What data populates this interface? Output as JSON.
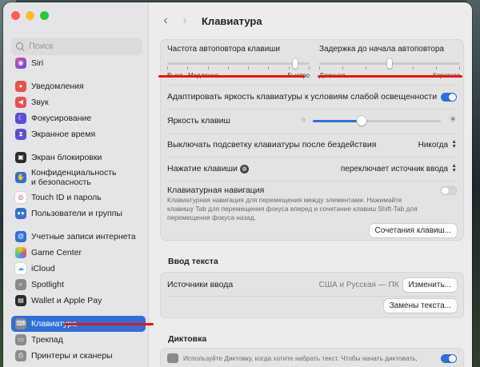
{
  "window": {
    "title": "Клавиатура"
  },
  "search": {
    "placeholder": "Поиск"
  },
  "sidebar": {
    "items": [
      {
        "label": "Siri",
        "icon": "siri-icon",
        "color": "#b04fd1"
      },
      {
        "label": "Уведомления",
        "icon": "bell-icon",
        "color": "#ec4d4d"
      },
      {
        "label": "Звук",
        "icon": "speaker-icon",
        "color": "#ec4d4d"
      },
      {
        "label": "Фокусирование",
        "icon": "moon-icon",
        "color": "#5a4fd6"
      },
      {
        "label": "Экранное время",
        "icon": "hourglass-icon",
        "color": "#5a4fd6"
      },
      {
        "label": "Экран блокировки",
        "icon": "lock-screen-icon",
        "color": "#2b2b2b"
      },
      {
        "label": "Конфиденциальность",
        "label2": "и безопасность",
        "icon": "hand-icon",
        "color": "#2f6fd7"
      },
      {
        "label": "Touch ID и пароль",
        "icon": "fingerprint-icon",
        "color": "#ffffff"
      },
      {
        "label": "Пользователи и группы",
        "icon": "users-icon",
        "color": "#2f6fd7"
      },
      {
        "label": "Учетные записи интернета",
        "icon": "at-icon",
        "color": "#2f6fd7"
      },
      {
        "label": "Game Center",
        "icon": "game-center-icon",
        "color": "#ffffff"
      },
      {
        "label": "iCloud",
        "icon": "cloud-icon",
        "color": "#3f9cf0"
      },
      {
        "label": "Spotlight",
        "icon": "spotlight-icon",
        "color": "#8a8a8e"
      },
      {
        "label": "Wallet и Apple Pay",
        "icon": "wallet-icon",
        "color": "#2b2b2b"
      },
      {
        "label": "Клавиатура",
        "icon": "keyboard-icon",
        "color": "#8a8a8e"
      },
      {
        "label": "Трекпад",
        "icon": "trackpad-icon",
        "color": "#8a8a8e"
      },
      {
        "label": "Принтеры и сканеры",
        "icon": "printer-icon",
        "color": "#8a8a8e"
      }
    ]
  },
  "repeat": {
    "rate_title": "Частота автоповтора клавиши",
    "rate_labels": [
      "Выкл.",
      "Медленно",
      "Быстро"
    ],
    "rate_value": 0.9,
    "delay_title": "Задержка до начала автоповтора",
    "delay_labels": [
      "Длинная",
      "Короткая"
    ],
    "delay_value": 0.5
  },
  "settings": {
    "brightness_adapt_label": "Адаптировать яркость клавиатуры к условиям слабой освещенности",
    "brightness_adapt_on": true,
    "brightness_label": "Яркость клавиш",
    "brightness_value": 0.38,
    "backlight_off_label": "Выключать подсветку клавиатуры после бездействия",
    "backlight_off_value": "Никогда",
    "press_key_label": "Нажатие клавиши",
    "press_key_value": "переключает источник ввода",
    "nav_label": "Клавиатурная навигация",
    "nav_desc": "Клавиатурная навигация для перемещения между элементами. Нажимайте клавишу Tab для перемещения фокуса вперед и сочетание клавиш Shift-Tab для перемещения фокуса назад.",
    "nav_on": false,
    "shortcuts_button": "Сочетания клавиш..."
  },
  "text_input": {
    "title": "Ввод текста",
    "sources_label": "Источники ввода",
    "sources_value": "США и Русская — ПК",
    "change_button": "Изменить...",
    "replacements_button": "Замены текста..."
  },
  "dictation": {
    "title": "Диктовка",
    "desc": "Используйте Диктовку, когда хотите набрать текст. Чтобы начать диктовать,",
    "on": true
  },
  "colors": {
    "accent": "#2f6fd7",
    "annotation": "#e8160f"
  }
}
